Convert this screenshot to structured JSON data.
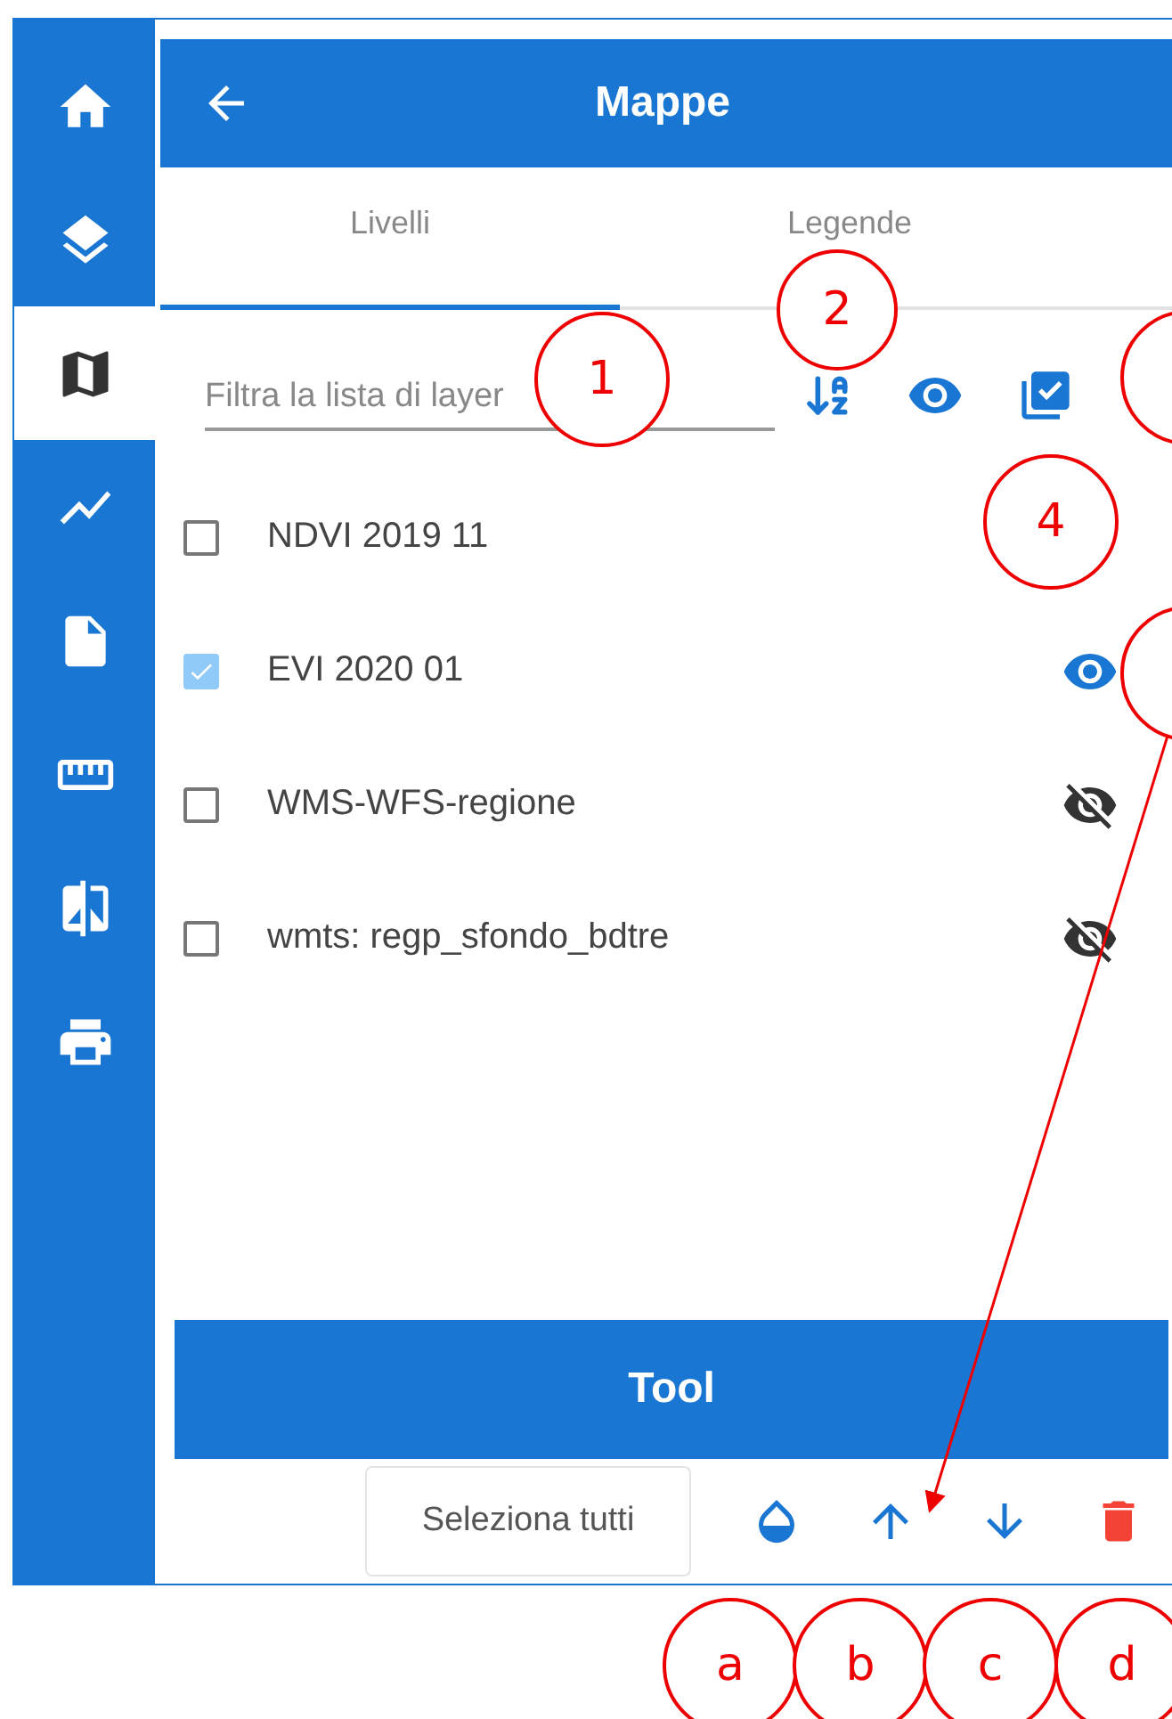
{
  "sidebar": {
    "items": [
      {
        "kind": "home",
        "selected": false
      },
      {
        "kind": "add-layer",
        "selected": false
      },
      {
        "kind": "map",
        "selected": true
      },
      {
        "kind": "chart",
        "selected": false
      },
      {
        "kind": "export",
        "selected": false
      },
      {
        "kind": "ruler",
        "selected": false
      },
      {
        "kind": "compare",
        "selected": false
      },
      {
        "kind": "print",
        "selected": false
      }
    ]
  },
  "header": {
    "title": "Mappe"
  },
  "tabs": [
    {
      "label": "Livelli",
      "selected": true
    },
    {
      "label": "Legende",
      "selected": false
    }
  ],
  "filter": {
    "placeholder": "Filtra la lista di layer"
  },
  "layers": [
    {
      "name": "NDVI 2019 11",
      "checked": false
    },
    {
      "name": "EVI 2020 01",
      "checked": true,
      "visible": true
    },
    {
      "name": "WMS-WFS-regione",
      "checked": false,
      "visible": false
    },
    {
      "name": "wmts: regp_sfondo_bdtre",
      "checked": false,
      "visible": false
    }
  ],
  "tool_button": "Tool",
  "select_all_button": "Seleziona tutti",
  "annotations": [
    {
      "label": "1"
    },
    {
      "label": "2"
    },
    {
      "label": "4"
    },
    {
      "label": "a"
    },
    {
      "label": "b"
    },
    {
      "label": "c"
    },
    {
      "label": "d"
    }
  ]
}
